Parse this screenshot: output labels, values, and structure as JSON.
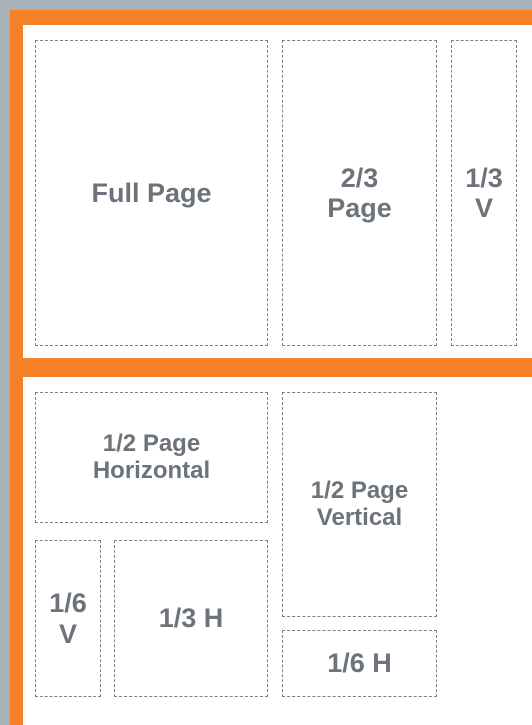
{
  "ad_sizes": {
    "full_page": "Full Page",
    "two_thirds_page": "2/3\nPage",
    "one_third_vertical": "1/3\nV",
    "half_page_horizontal": "1/2 Page\nHorizontal",
    "half_page_vertical": "1/2 Page\nVertical",
    "one_sixth_vertical": "1/6\nV",
    "one_third_horizontal": "1/3 H",
    "one_sixth_horizontal": "1/6 H"
  },
  "colors": {
    "frame": "#f58026",
    "background": "#a9b0b6",
    "panel": "#ffffff",
    "label": "#6d737b",
    "dashed_border": "#7a8088"
  }
}
